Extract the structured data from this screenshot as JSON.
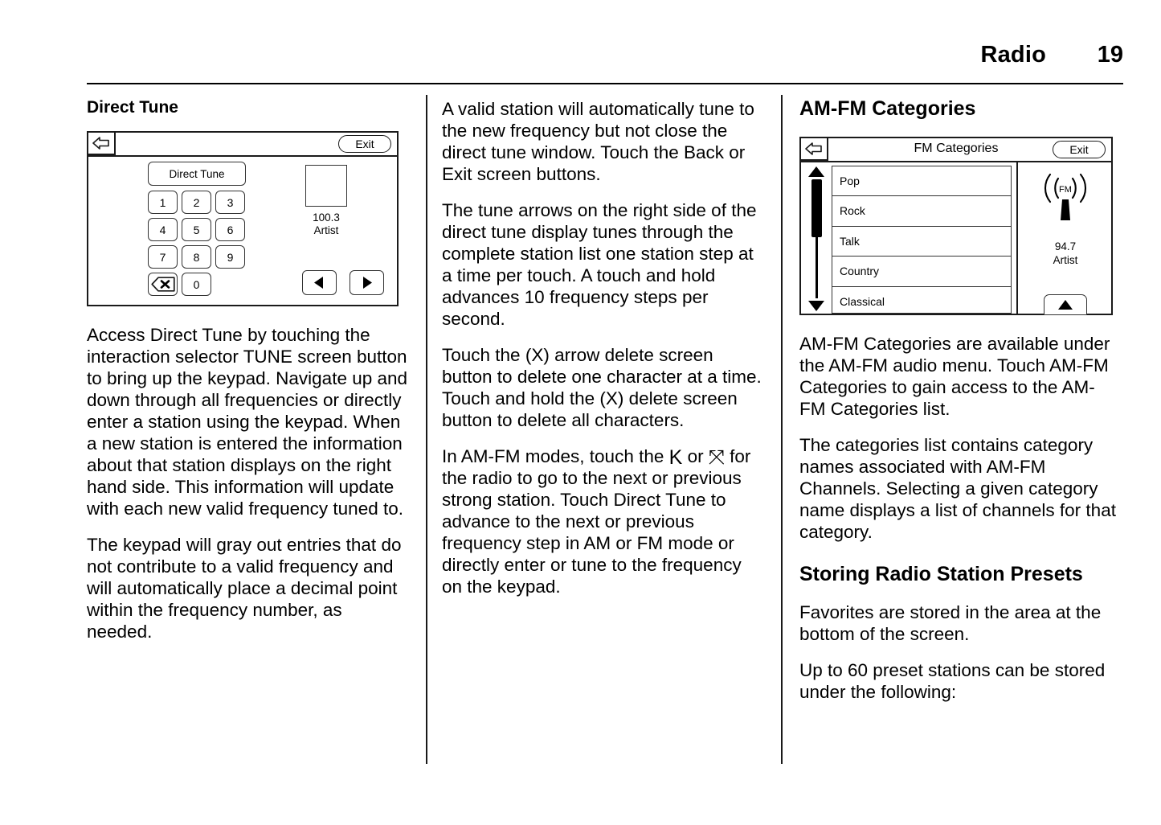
{
  "header": {
    "title": "Radio",
    "page_number": "19"
  },
  "column1": {
    "heading": "Direct Tune",
    "figure": {
      "back_icon": "back-arrow-icon",
      "exit_label": "Exit",
      "direct_tune_label": "Direct Tune",
      "keys": [
        "1",
        "2",
        "3",
        "4",
        "5",
        "6",
        "7",
        "8",
        "9"
      ],
      "delete_key_icon": "backspace-delete-icon",
      "zero_key": "0",
      "album_art_icon": "album-art-placeholder",
      "station_frequency": "100.3",
      "station_artist": "Artist",
      "prev_arrow_icon": "left-triangle-icon",
      "next_arrow_icon": "right-triangle-icon"
    },
    "paragraphs": [
      "Access Direct Tune by touching the interaction selector TUNE screen button to bring up the keypad. Navigate up and down through all frequencies or directly enter a station using the keypad. When a new station is entered the information about that station displays on the right hand side. This information will update with each new valid frequency tuned to.",
      "The keypad will gray out entries that do not contribute to a valid frequency and will automatically place a decimal point within the frequency number, as needed."
    ]
  },
  "column2": {
    "paragraphs": [
      "A valid station will automatically tune to the new frequency but not close the direct tune window. Touch the Back or Exit screen buttons.",
      "The tune arrows on the right side of the direct tune display tunes through the complete station list one station step at a time per touch. A touch and hold advances 10 frequency steps per second.",
      "Touch the (X) arrow delete screen button to delete one character at a time. Touch and hold the (X) delete screen button to delete all characters."
    ],
    "seek_paragraph": {
      "part1": "In AM-FM modes, touch the ",
      "seek_prev_glyph": "K",
      "part2": " or ",
      "seek_next_glyph": "⤧",
      "part3": " for the radio to go to the next or previous strong station. Touch Direct Tune to advance to the next or previous frequency step in AM or FM mode or directly enter or tune to the frequency on the keypad."
    }
  },
  "column3": {
    "heading": "AM-FM Categories",
    "figure": {
      "back_icon": "back-arrow-icon",
      "screen_title": "FM Categories",
      "exit_label": "Exit",
      "scroll_up_icon": "scroll-up-triangle-icon",
      "scroll_down_icon": "scroll-down-triangle-icon",
      "categories": [
        "Pop",
        "Rock",
        "Talk",
        "Country",
        "Classical"
      ],
      "fm_icon_label": "FM",
      "station_frequency": "94.7",
      "station_artist": "Artist",
      "up_button_icon": "up-triangle-icon"
    },
    "paragraphs": [
      "AM-FM Categories are available under the AM-FM audio menu. Touch AM-FM Categories to gain access to the AM-FM Categories list.",
      "The categories list contains category names associated with AM-FM Channels. Selecting a given category name displays a list of channels for that category."
    ],
    "subheading": "Storing Radio Station Presets",
    "paragraphs2": [
      "Favorites are stored in the area at the bottom of the screen.",
      "Up to 60 preset stations can be stored under the following:"
    ]
  }
}
